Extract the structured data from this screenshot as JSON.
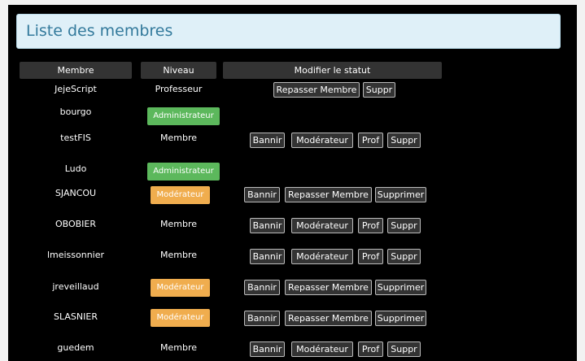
{
  "page_title": "Liste des membres",
  "columns": {
    "member": "Membre",
    "level": "Niveau",
    "status": "Modifier le statut"
  },
  "labels": {
    "bannir": "Bannir",
    "moderateur": "Modérateur",
    "prof": "Prof",
    "suppr": "Suppr",
    "repasser_membre": "Repasser Membre",
    "supprimer": "Supprimer"
  },
  "colors": {
    "admin_badge": "#5cb85c",
    "moderator_badge": "#f0ad4e",
    "title_text": "#337a9c"
  },
  "members": [
    {
      "name": "JejeScript",
      "level": "Professeur",
      "level_style": "text",
      "actions": [
        "repasser_membre",
        "suppr"
      ]
    },
    {
      "name": "bourgo",
      "level": "Administrateur",
      "level_style": "admin",
      "actions": []
    },
    {
      "name": "testFIS",
      "level": "Membre",
      "level_style": "text",
      "actions": [
        "bannir",
        "moderateur",
        "prof",
        "suppr"
      ]
    },
    {
      "name": "Ludo",
      "level": "Administrateur",
      "level_style": "admin",
      "actions": []
    },
    {
      "name": "SJANCOU",
      "level": "Modérateur",
      "level_style": "mod",
      "actions": [
        "bannir",
        "repasser_membre",
        "supprimer"
      ]
    },
    {
      "name": "OBOBIER",
      "level": "Membre",
      "level_style": "text",
      "actions": [
        "bannir",
        "moderateur",
        "prof",
        "suppr"
      ]
    },
    {
      "name": "lmeissonnier",
      "level": "Membre",
      "level_style": "text",
      "actions": [
        "bannir",
        "moderateur",
        "prof",
        "suppr"
      ]
    },
    {
      "name": "jreveillaud",
      "level": "Modérateur",
      "level_style": "mod",
      "actions": [
        "bannir",
        "repasser_membre",
        "supprimer"
      ]
    },
    {
      "name": "SLASNIER",
      "level": "Modérateur",
      "level_style": "mod",
      "actions": [
        "bannir",
        "repasser_membre",
        "supprimer"
      ]
    },
    {
      "name": "guedem",
      "level": "Membre",
      "level_style": "text",
      "actions": [
        "bannir",
        "moderateur",
        "prof",
        "suppr"
      ]
    }
  ]
}
